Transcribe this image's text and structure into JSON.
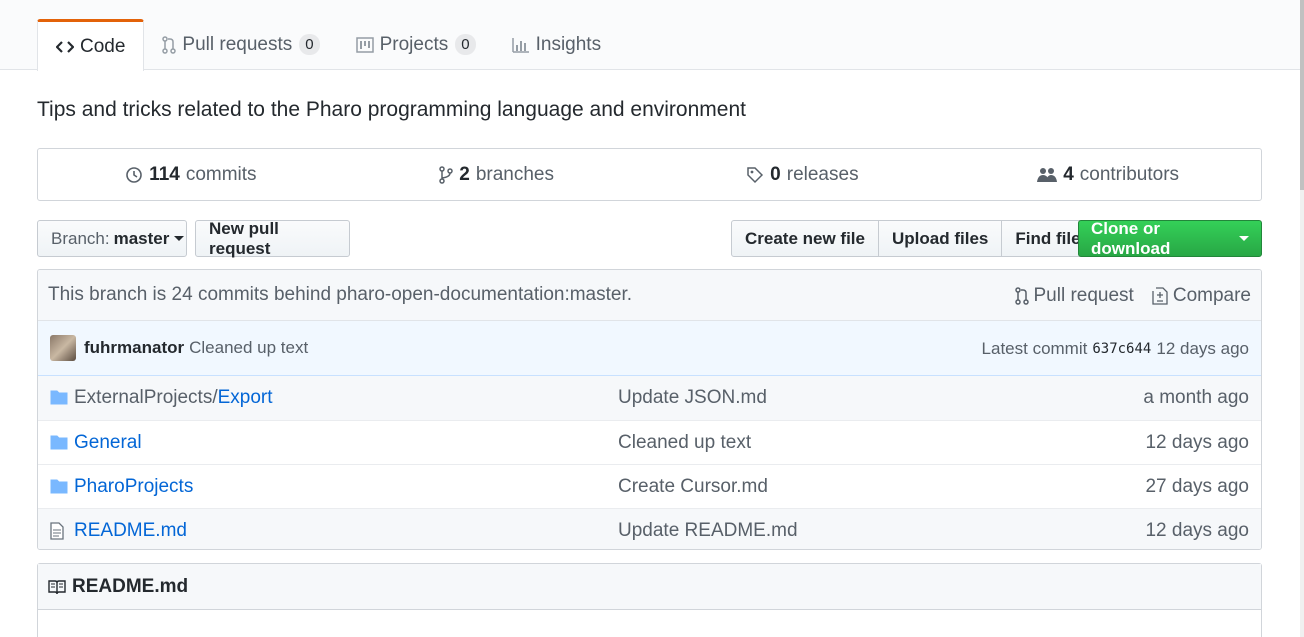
{
  "tabs": [
    {
      "label": "Code",
      "icon": "code-icon",
      "selected": true
    },
    {
      "label": "Pull requests",
      "icon": "git-pull-request-icon",
      "count": "0"
    },
    {
      "label": "Projects",
      "icon": "project-icon",
      "count": "0"
    },
    {
      "label": "Insights",
      "icon": "graph-icon"
    }
  ],
  "description": "Tips and tricks related to the Pharo programming language and environment",
  "summary": {
    "commits": {
      "num": "114",
      "label": "commits"
    },
    "branches": {
      "num": "2",
      "label": "branches"
    },
    "releases": {
      "num": "0",
      "label": "releases"
    },
    "contributors": {
      "num": "4",
      "label": "contributors"
    }
  },
  "toolbar": {
    "branch_prefix": "Branch:",
    "branch_name": "master",
    "new_pull_request": "New pull request",
    "create_new_file": "Create new file",
    "upload_files": "Upload files",
    "find_file": "Find file",
    "clone_or_download": "Clone or download"
  },
  "branch_info": {
    "text": "This branch is 24 commits behind pharo-open-documentation:master.",
    "pull_request": "Pull request",
    "compare": "Compare"
  },
  "latest_commit": {
    "author": "fuhrmanator",
    "message": "Cleaned up text",
    "latest_label": "Latest commit",
    "sha": "637c644",
    "age": "12 days ago"
  },
  "files": [
    {
      "type": "directory",
      "prefix": "ExternalProjects/",
      "name": "Export",
      "message": "Update JSON.md",
      "age": "a month ago"
    },
    {
      "type": "directory",
      "prefix": "",
      "name": "General",
      "message": "Cleaned up text",
      "age": "12 days ago"
    },
    {
      "type": "directory",
      "prefix": "",
      "name": "PharoProjects",
      "message": "Create Cursor.md",
      "age": "27 days ago"
    },
    {
      "type": "file",
      "prefix": "",
      "name": "README.md",
      "message": "Update README.md",
      "age": "12 days ago"
    }
  ],
  "readme": {
    "title": "README.md"
  },
  "colors": {
    "accent_tab": "#e36209",
    "link": "#0366d6",
    "clone_green": "#28a745",
    "commit_bar": "#f1f8ff"
  }
}
